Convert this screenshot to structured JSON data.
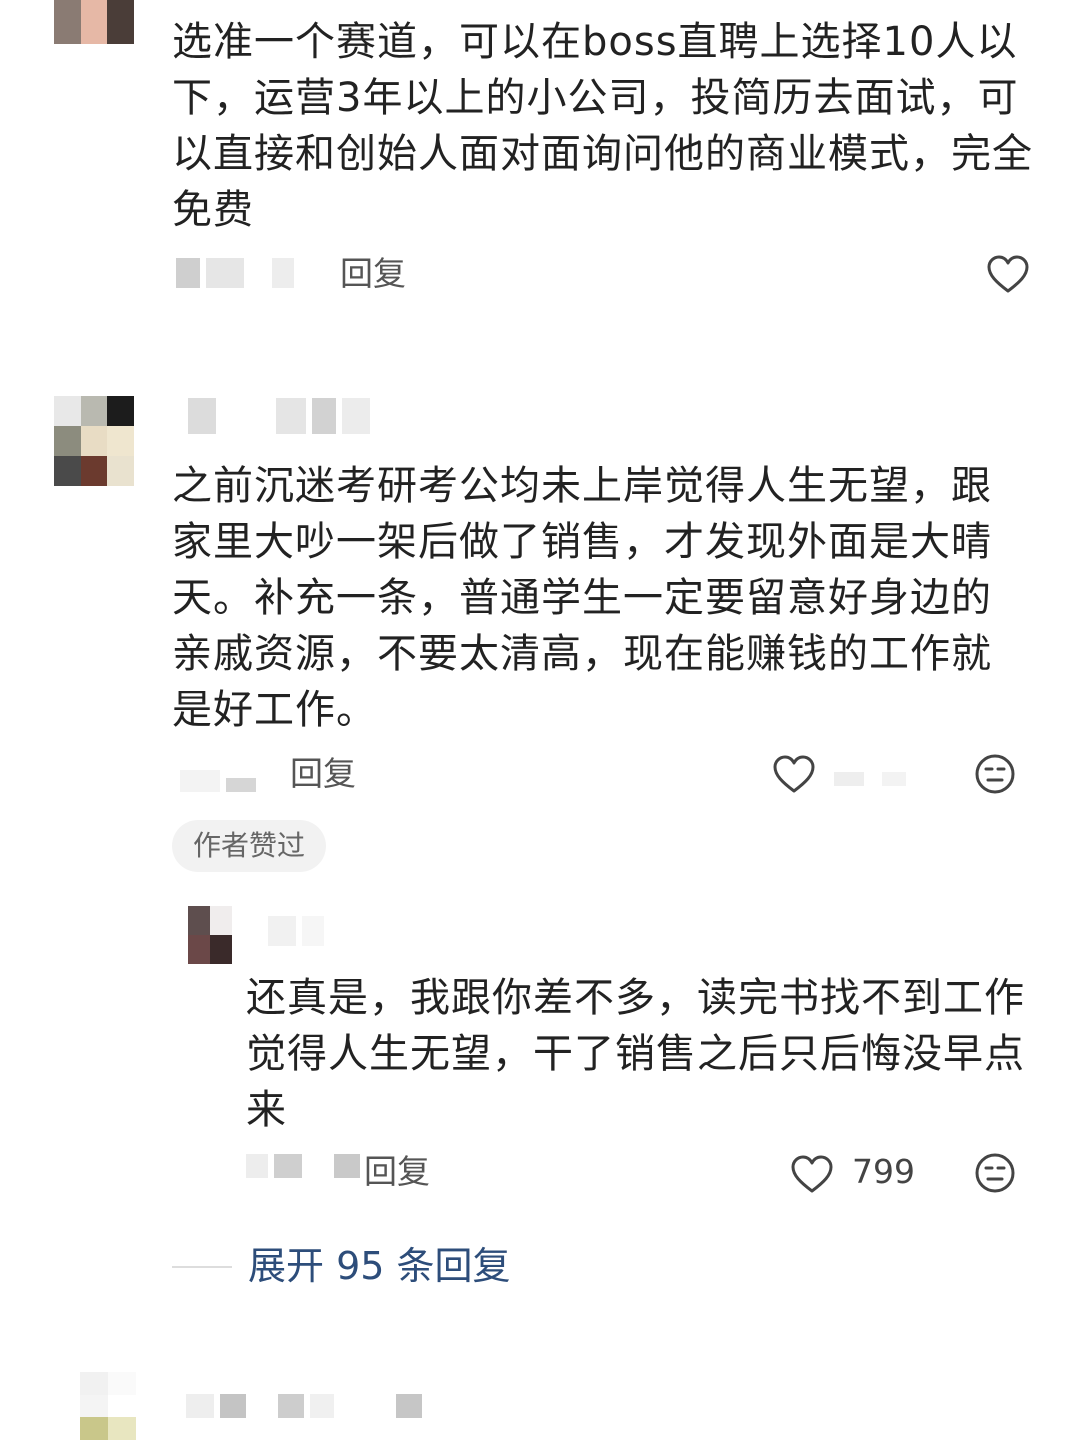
{
  "comments": [
    {
      "text": "选准一个赛道，可以在boss直聘上选择10人以下，运营3年以上的小公司，投简历去面试，可以直接和创始人面对面询问他的商业模式，完全免费",
      "reply_label": "回复",
      "like_icon": "heart-outline-icon"
    },
    {
      "text": "之前沉迷考研考公均未上岸觉得人生无望，跟家里大吵一架后做了销售，才发现外面是大晴天。补充一条，普通学生一定要留意好身边的亲戚资源，不要太清高，现在能赚钱的工作就是好工作。",
      "reply_label": "回复",
      "like_icon": "heart-outline-icon",
      "dislike_icon": "meh-face-icon",
      "author_badge": "作者赞过",
      "replies": [
        {
          "text": "还真是，我跟你差不多，读完书找不到工作觉得人生无望，干了销售之后只后悔没早点来",
          "reply_label": "回复",
          "like_count": "799",
          "like_icon": "heart-outline-icon",
          "dislike_icon": "meh-face-icon"
        }
      ],
      "expand_label": "展开 95 条回复"
    }
  ],
  "colors": {
    "text": "#222222",
    "muted": "#555555",
    "link": "#2d4d7a",
    "badge_bg": "#f2f2f2"
  }
}
